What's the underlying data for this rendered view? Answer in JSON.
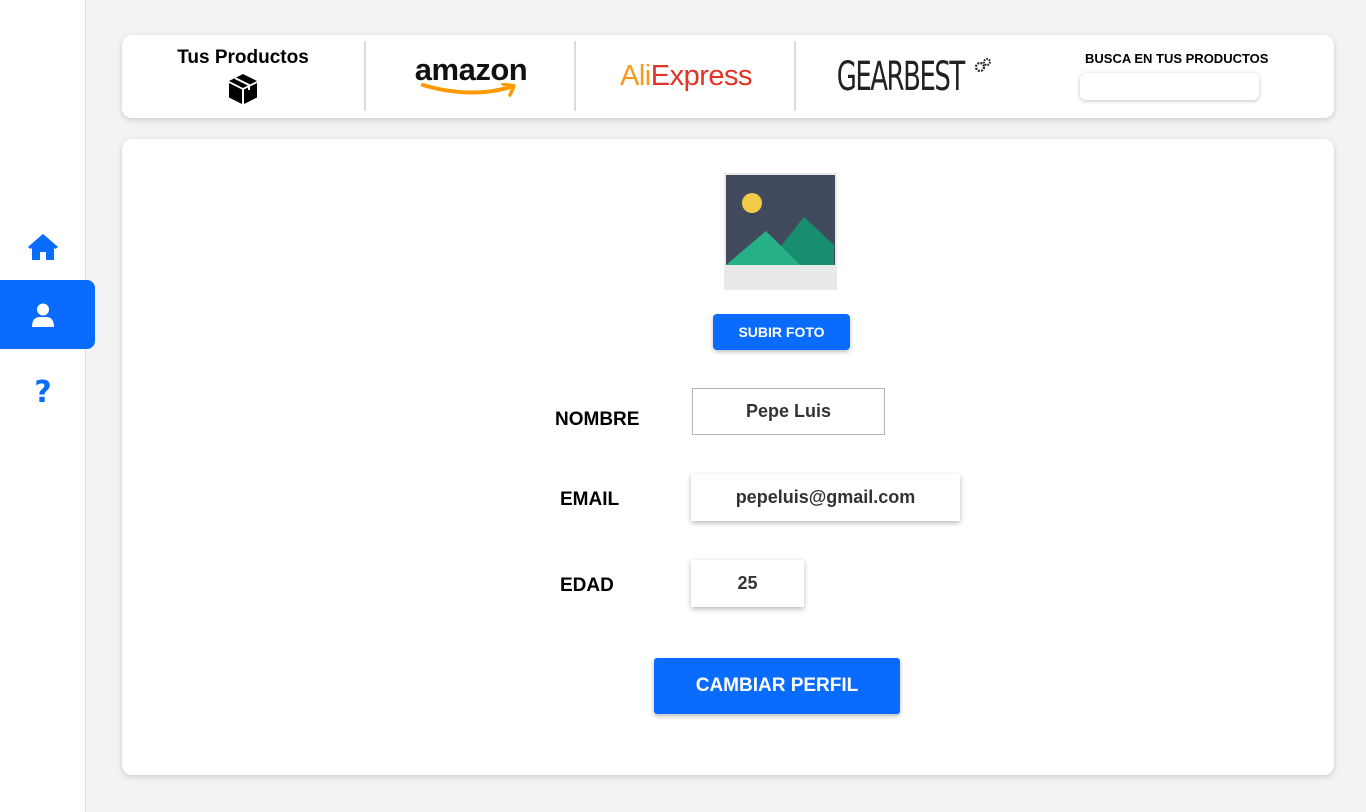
{
  "sidebar": {
    "items": [
      {
        "icon": "home-icon",
        "active": false
      },
      {
        "icon": "user-icon",
        "active": true
      },
      {
        "icon": "question-icon",
        "active": false
      }
    ],
    "help_glyph": "?"
  },
  "topbar": {
    "products_label": "Tus Productos",
    "amazon_text": "amazon",
    "aliexpress_a": "Ali",
    "aliexpress_b": "Express",
    "gearbest_text": "GEARBEST",
    "search_title": "BUSCA EN TUS PRODUCTOS",
    "search_value": ""
  },
  "profile": {
    "upload_label": "SUBIR FOTO",
    "fields": {
      "nombre_label": "NOMBRE",
      "nombre_value": "Pepe Luis",
      "email_label": "EMAIL",
      "email_value": "pepeluis@gmail.com",
      "edad_label": "EDAD",
      "edad_value": "25"
    },
    "submit_label": "CAMBIAR PERFIL"
  },
  "colors": {
    "accent": "#0a6cff",
    "aliexpress_red": "#e43225",
    "aliexpress_orange": "#f79a1c",
    "amazon_smile": "#ff9900"
  }
}
